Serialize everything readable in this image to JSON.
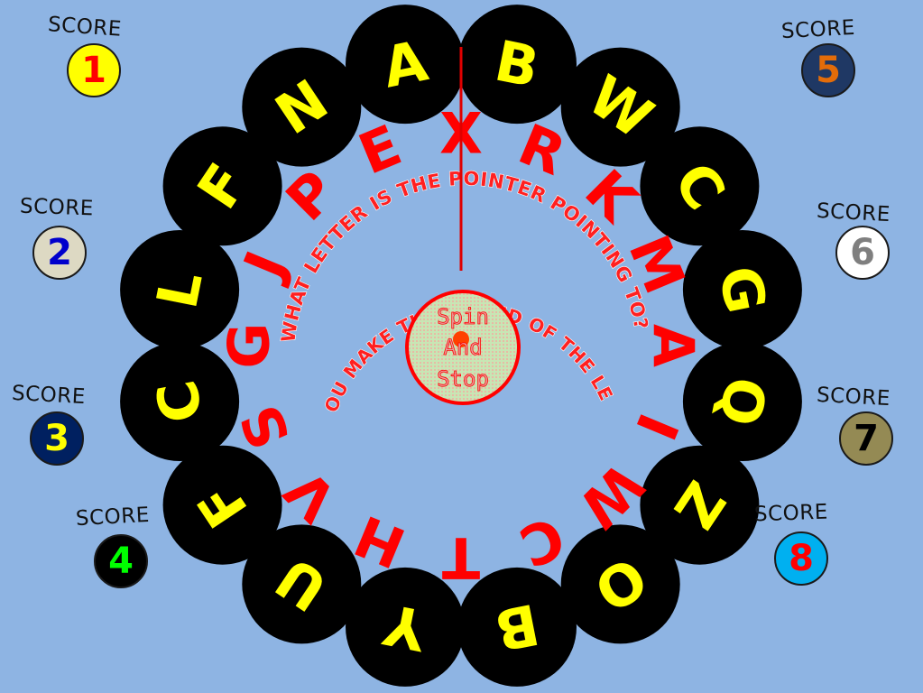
{
  "colors": {
    "background": "#8eb4e3",
    "wheel_disc": "#000000",
    "letter_yellow": "#ffff00",
    "letter_red": "#ff0000",
    "pointer": "#e00000"
  },
  "wheel": {
    "outer_letters": [
      {
        "letter": "A",
        "color": "yellow"
      },
      {
        "letter": "B",
        "color": "yellow"
      },
      {
        "letter": "W",
        "color": "yellow"
      },
      {
        "letter": "C",
        "color": "yellow"
      },
      {
        "letter": "G",
        "color": "yellow"
      },
      {
        "letter": "Q",
        "color": "yellow"
      },
      {
        "letter": "Z",
        "color": "yellow"
      },
      {
        "letter": "O",
        "color": "yellow"
      },
      {
        "letter": "B",
        "color": "yellow"
      },
      {
        "letter": "Y",
        "color": "yellow"
      },
      {
        "letter": "U",
        "color": "yellow"
      },
      {
        "letter": "F",
        "color": "yellow"
      },
      {
        "letter": "C",
        "color": "yellow"
      },
      {
        "letter": "L",
        "color": "yellow"
      },
      {
        "letter": "F",
        "color": "yellow"
      },
      {
        "letter": "N",
        "color": "yellow"
      }
    ],
    "inner_letters": [
      {
        "letter": "X",
        "color": "red"
      },
      {
        "letter": "R",
        "color": "red"
      },
      {
        "letter": "K",
        "color": "red"
      },
      {
        "letter": "M",
        "color": "red"
      },
      {
        "letter": "A",
        "color": "red"
      },
      {
        "letter": "I",
        "color": "red"
      },
      {
        "letter": "W",
        "color": "red"
      },
      {
        "letter": "C",
        "color": "red"
      },
      {
        "letter": "T",
        "color": "red"
      },
      {
        "letter": "H",
        "color": "red"
      },
      {
        "letter": "V",
        "color": "red"
      },
      {
        "letter": "S",
        "color": "red"
      },
      {
        "letter": "G",
        "color": "red"
      },
      {
        "letter": "J",
        "color": "red"
      },
      {
        "letter": "P",
        "color": "red"
      },
      {
        "letter": "E",
        "color": "red"
      }
    ],
    "question_1": "WHAT LETTER IS THE POINTER POINTING TO?",
    "question_2": "CAN YOU MAKE THE SOUND OF THE LETTER?"
  },
  "spin_button": {
    "line1": "Spin",
    "line2": "And",
    "line3": "Stop"
  },
  "scores": [
    {
      "label": "SCORE",
      "number": "1",
      "disc_color": "#ffff00",
      "text_color": "#ff0000"
    },
    {
      "label": "SCORE",
      "number": "2",
      "disc_color": "#ddd9c3",
      "text_color": "#0000cc"
    },
    {
      "label": "SCORE",
      "number": "3",
      "disc_color": "#002060",
      "text_color": "#ffff00"
    },
    {
      "label": "SCORE",
      "number": "4",
      "disc_color": "#000000",
      "text_color": "#00ff00"
    },
    {
      "label": "SCORE",
      "number": "5",
      "disc_color": "#1f3864",
      "text_color": "#e36c09"
    },
    {
      "label": "SCORE",
      "number": "6",
      "disc_color": "#ffffff",
      "text_color": "#7f7f7f"
    },
    {
      "label": "SCORE",
      "number": "7",
      "disc_color": "#948a54",
      "text_color": "#000000"
    },
    {
      "label": "SCORE",
      "number": "8",
      "disc_color": "#00b0f0",
      "text_color": "#ff0000"
    }
  ]
}
